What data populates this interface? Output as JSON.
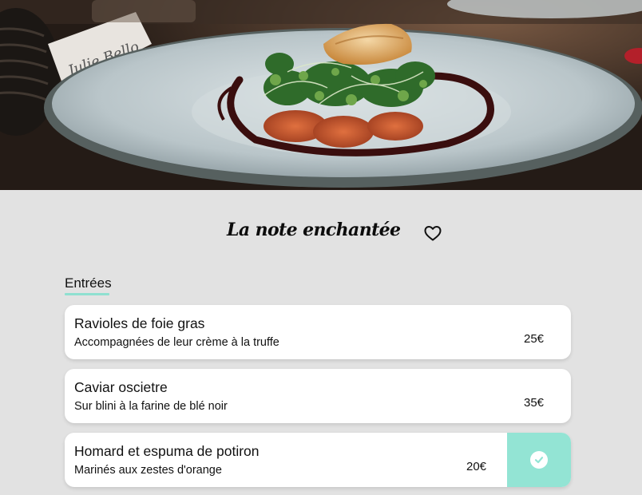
{
  "restaurant": {
    "title": "La note enchantée",
    "favorite_icon": "heart-outline-icon"
  },
  "section": {
    "label": "Entrées",
    "accent_color": "#8fe0d0"
  },
  "items": [
    {
      "name": "Ravioles de foie gras",
      "description": "Accompagnées de leur crème à la truffe",
      "price": "25€",
      "selected": false
    },
    {
      "name": "Caviar oscietre",
      "description": "Sur blini à la farine de blé noir",
      "price": "35€",
      "selected": false
    },
    {
      "name": "Homard et espuma de potiron",
      "description": "Marinés aux zestes d'orange",
      "price": "20€",
      "selected": true,
      "selected_icon": "check-circle-icon",
      "selected_color": "#93e4d4"
    }
  ]
}
